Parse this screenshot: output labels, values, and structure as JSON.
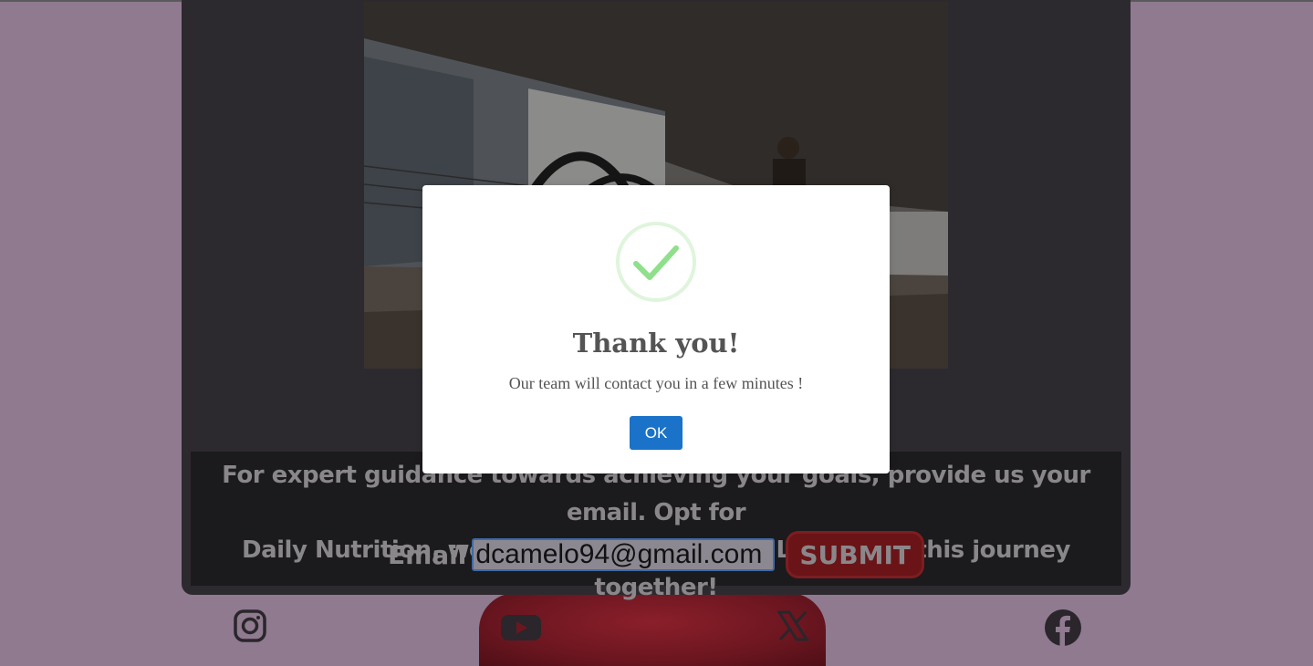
{
  "cta": {
    "text_line1": "For expert guidance towards achieving your goals, provide us your email. Opt for",
    "text_line2": "Daily Nutrition, we are the smart choice. Let's start this journey together!",
    "email_label": "Email",
    "email_value": "dcamelo94@gmail.com",
    "submit_label": "SUBMIT"
  },
  "modal": {
    "icon": "success-check-icon",
    "title": "Thank you!",
    "message": "Our team will contact you in a few minutes !",
    "ok_label": "OK"
  },
  "social": {
    "icons": [
      "instagram-icon",
      "youtube-icon",
      "x-icon",
      "facebook-icon"
    ]
  },
  "colors": {
    "backdrop": "#8f7a90",
    "card": "#2d2a2f",
    "ok_button": "#1a73c8",
    "submit_button": "#6a1418",
    "check": "#8ee08a"
  }
}
